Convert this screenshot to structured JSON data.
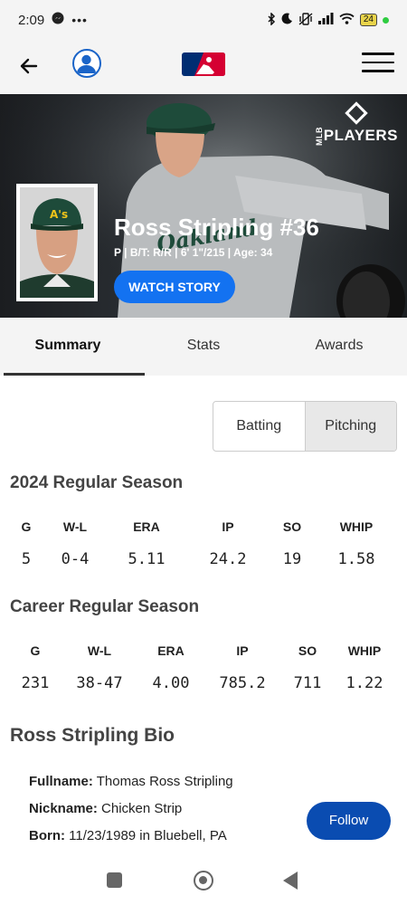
{
  "status_bar": {
    "time": "2:09",
    "battery": "24",
    "left_icons": [
      "messenger-icon",
      "more-dots-icon"
    ],
    "right_icons": [
      "bluetooth-icon",
      "moon-icon",
      "vibrate-icon",
      "signal-icon",
      "wifi-icon"
    ]
  },
  "header": {
    "icons": [
      "back-arrow-icon",
      "profile-icon",
      "mlb-logo",
      "hamburger-menu-icon"
    ]
  },
  "hero": {
    "brand": "PLAYERS",
    "brand_prefix": "MLB",
    "name": "Ross Stripling #36",
    "meta": "P | B/T: R/R | 6' 1\"/215 | Age: 34",
    "watch_label": "WATCH STORY",
    "jersey_text": "Oakland"
  },
  "tabs": [
    "Summary",
    "Stats",
    "Awards"
  ],
  "active_tab": "Summary",
  "toggle": {
    "batting": "Batting",
    "pitching": "Pitching",
    "selected": "Pitching"
  },
  "season": {
    "title": "2024 Regular Season",
    "headers": [
      "G",
      "W-L",
      "ERA",
      "IP",
      "SO",
      "WHIP"
    ],
    "values": [
      "5",
      "0-4",
      "5.11",
      "24.2",
      "19",
      "1.58"
    ]
  },
  "career": {
    "title": "Career Regular Season",
    "headers": [
      "G",
      "W-L",
      "ERA",
      "IP",
      "SO",
      "WHIP"
    ],
    "values": [
      "231",
      "38-47",
      "4.00",
      "785.2",
      "711",
      "1.22"
    ]
  },
  "bio": {
    "title": "Ross Stripling Bio",
    "fullname_label": "Fullname:",
    "fullname": "Thomas Ross Stripling",
    "nickname_label": "Nickname:",
    "nickname": "Chicken Strip",
    "born_label": "Born:",
    "born": "11/23/1989 in Bluebell, PA"
  },
  "follow_label": "Follow",
  "colors": {
    "accent": "#1372f1",
    "follow": "#0a4cb1",
    "profile_ring": "#1a64c8"
  }
}
